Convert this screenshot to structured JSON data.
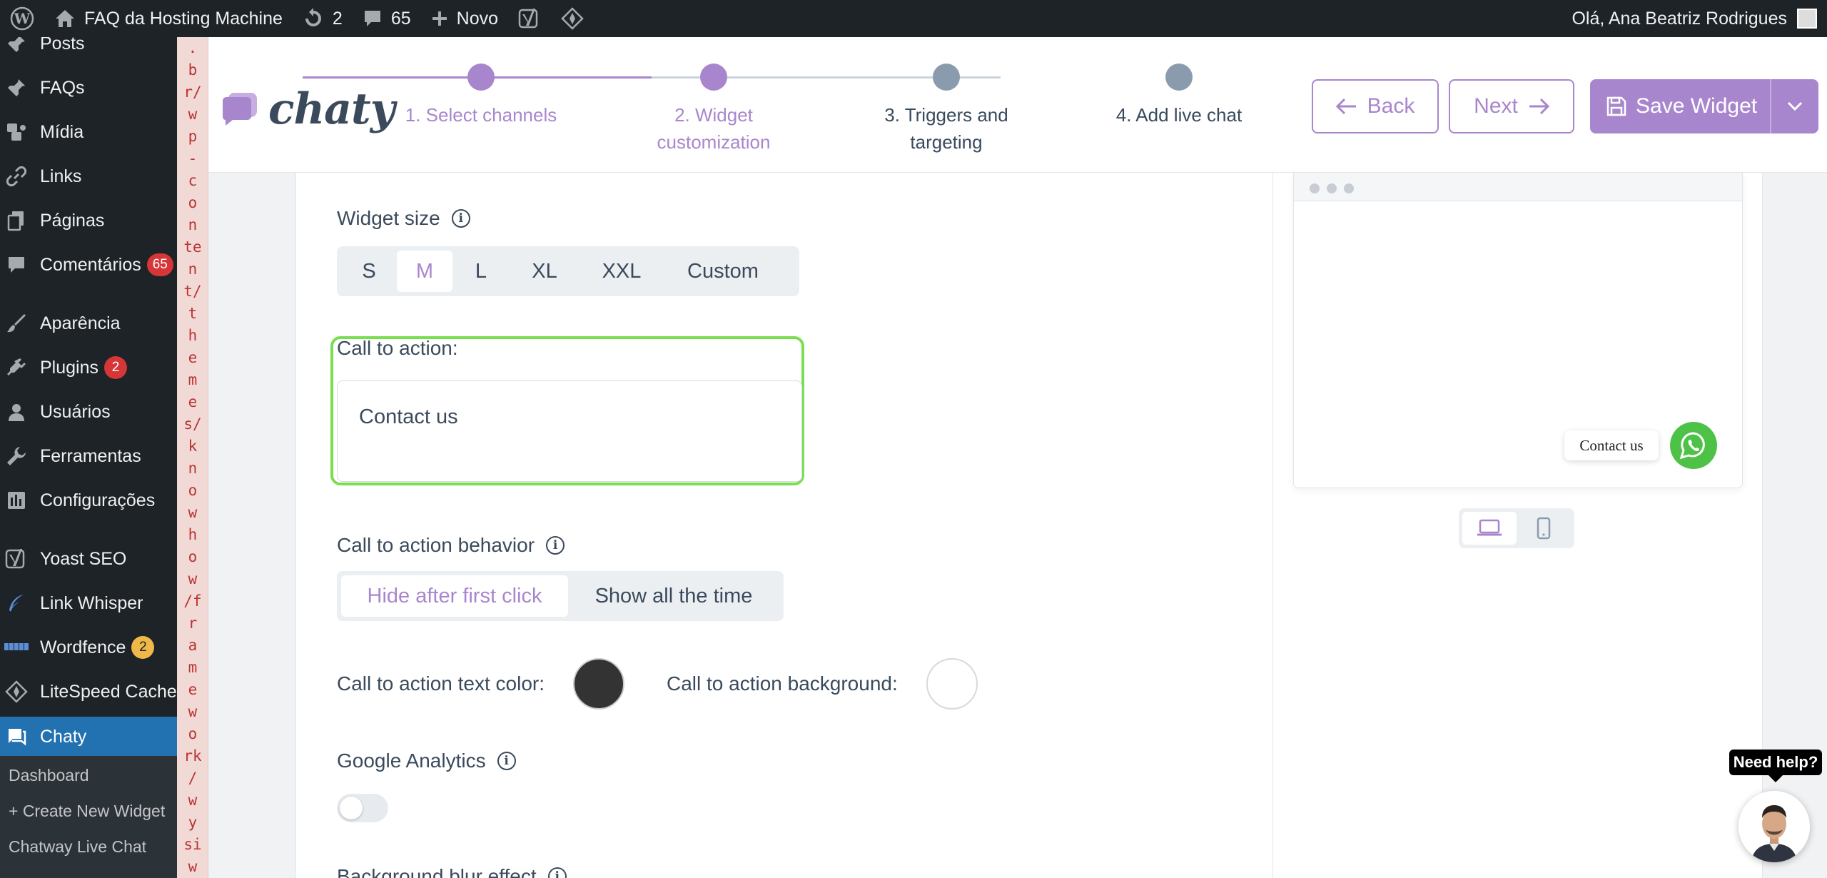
{
  "adminbar": {
    "site_name": "FAQ da Hosting Machine",
    "updates_count": "2",
    "comments_count": "65",
    "new_label": "Novo",
    "greeting": "Olá, Ana Beatriz Rodrigues"
  },
  "sidebar": {
    "items": [
      {
        "label": "Posts",
        "icon": "pushpin-icon"
      },
      {
        "label": "FAQs",
        "icon": "pushpin-icon"
      },
      {
        "label": "Mídia",
        "icon": "media-icon"
      },
      {
        "label": "Links",
        "icon": "link-icon"
      },
      {
        "label": "Páginas",
        "icon": "pages-icon"
      },
      {
        "label": "Comentários",
        "icon": "comment-icon",
        "badge": "65"
      },
      {
        "label": "Aparência",
        "icon": "brush-icon"
      },
      {
        "label": "Plugins",
        "icon": "plugin-icon",
        "badge": "2"
      },
      {
        "label": "Usuários",
        "icon": "user-icon"
      },
      {
        "label": "Ferramentas",
        "icon": "wrench-icon"
      },
      {
        "label": "Configurações",
        "icon": "settings-icon"
      },
      {
        "label": "Yoast SEO",
        "icon": "yoast-icon"
      },
      {
        "label": "Link Whisper",
        "icon": "feather-icon"
      },
      {
        "label": "Wordfence",
        "icon": "wordfence-icon",
        "badge": "2"
      },
      {
        "label": "LiteSpeed Cache",
        "icon": "diamond-icon"
      },
      {
        "label": "Chaty",
        "icon": "chat-icon"
      }
    ],
    "submenu": [
      "Dashboard",
      "+ Create New Widget",
      "Chatway Live Chat"
    ]
  },
  "path_strip": [
    ".",
    "b",
    "r/",
    "w",
    "p",
    "-",
    "c",
    "o",
    "n",
    "te",
    "n",
    "t/",
    "t",
    "h",
    "e",
    "m",
    "e",
    "s/",
    "k",
    "n",
    "o",
    "w",
    "h",
    "o",
    "w",
    "/f",
    "r",
    "a",
    "m",
    "e",
    "w",
    "o",
    "rk",
    "/",
    "w",
    "y",
    "si",
    "w"
  ],
  "chaty": {
    "logo_text": "chaty",
    "steps": [
      "1. Select channels",
      "2. Widget customization",
      "3. Triggers and targeting",
      "4. Add live chat"
    ],
    "back_label": "Back",
    "next_label": "Next",
    "save_label": "Save Widget",
    "accent": "#a886cd"
  },
  "form": {
    "widget_size_label": "Widget size",
    "sizes": [
      "S",
      "M",
      "L",
      "XL",
      "XXL",
      "Custom"
    ],
    "selected_size": "M",
    "cta_label": "Call to action:",
    "cta_value": "Contact us",
    "cta_behavior_label": "Call to action behavior",
    "behavior_options": [
      "Hide after first click",
      "Show all the time"
    ],
    "selected_behavior": "Hide after first click",
    "text_color_label": "Call to action text color:",
    "text_color": "#333333",
    "bg_label": "Call to action background:",
    "bg_color": "#ffffff",
    "ga_label": "Google Analytics",
    "ga_enabled": false,
    "blur_label": "Background blur effect"
  },
  "preview": {
    "cta_text": "Contact us",
    "channel_icon": "whatsapp-icon",
    "channel_color": "#4dc247"
  },
  "help": {
    "label": "Need help?"
  }
}
